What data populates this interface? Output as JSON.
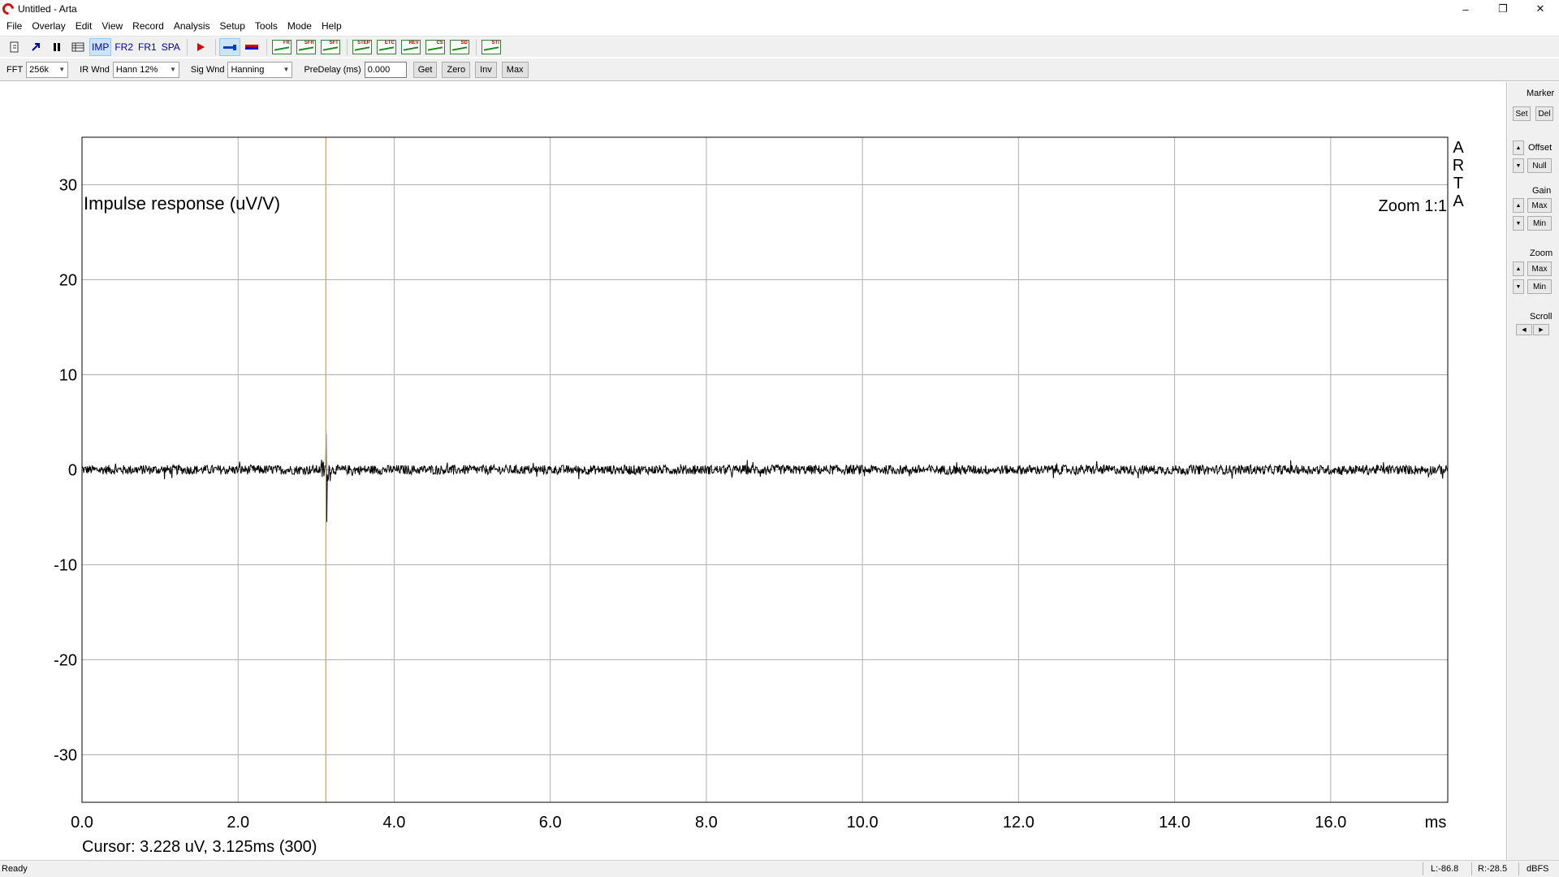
{
  "window": {
    "title": "Untitled - Arta",
    "controls": [
      "–",
      "❐",
      "✕"
    ]
  },
  "menu": [
    "File",
    "Overlay",
    "Edit",
    "View",
    "Record",
    "Analysis",
    "Setup",
    "Tools",
    "Mode",
    "Help"
  ],
  "toolbar": {
    "modes": [
      "IMP",
      "FR2",
      "FR1",
      "SPA"
    ],
    "active_mode": "IMP",
    "graph_tools": [
      "FR",
      "SFR",
      "SFT",
      "STEP",
      "ETC",
      "REV",
      "CS",
      "SD",
      "STI"
    ]
  },
  "params": {
    "fft_label": "FFT",
    "fft_value": "256k",
    "ir_wnd_label": "IR Wnd",
    "ir_wnd_value": "Hann 12%",
    "sig_wnd_label": "Sig Wnd",
    "sig_wnd_value": "Hanning",
    "predelay_label": "PreDelay (ms)",
    "predelay_value": "0.000",
    "buttons": [
      "Get",
      "Zero",
      "Inv",
      "Max"
    ]
  },
  "plot": {
    "zoom": "Zoom 1:1",
    "brand": [
      "A",
      "R",
      "T",
      "A"
    ],
    "cursor_text": "Cursor: 3.228 uV, 3.125ms (300)",
    "x_unit": "ms",
    "cursor_x": 3.125,
    "trace_color": "#000000",
    "cursor_color": "#c8b400",
    "grid_color": "#b0b0b0"
  },
  "chart_data": {
    "type": "line",
    "title": "Impulse response (uV/V)",
    "xlabel": "ms",
    "ylabel": "",
    "xlim": [
      0,
      17.5
    ],
    "ylim": [
      -35,
      35
    ],
    "x_ticks": [
      0,
      2,
      4,
      6,
      8,
      10,
      12,
      14,
      16
    ],
    "x_tick_labels": [
      "0.0",
      "2.0",
      "4.0",
      "6.0",
      "8.0",
      "10.0",
      "12.0",
      "14.0",
      "16.0"
    ],
    "y_ticks": [
      30,
      20,
      10,
      0,
      -10,
      -20,
      -30
    ],
    "y_tick_labels": [
      "30",
      "20",
      "10",
      "0",
      "-10",
      "-20",
      "-30"
    ],
    "grid": true,
    "noise_amplitude": 0.5,
    "impulse": {
      "x": 3.125,
      "peak": 3.8,
      "trough": -5.5
    }
  },
  "side": {
    "marker_label": "Marker",
    "set": "Set",
    "del": "Del",
    "offset_label": "Offset",
    "null": "Null",
    "gain_label": "Gain",
    "gain_max": "Max",
    "gain_min": "Min",
    "zoom_label": "Zoom",
    "zoom_max": "Max",
    "zoom_min": "Min",
    "scroll_label": "Scroll"
  },
  "status": {
    "ready": "Ready",
    "left_level": "L:-86.8",
    "right_level": "R:-28.5",
    "units": "dBFS"
  }
}
